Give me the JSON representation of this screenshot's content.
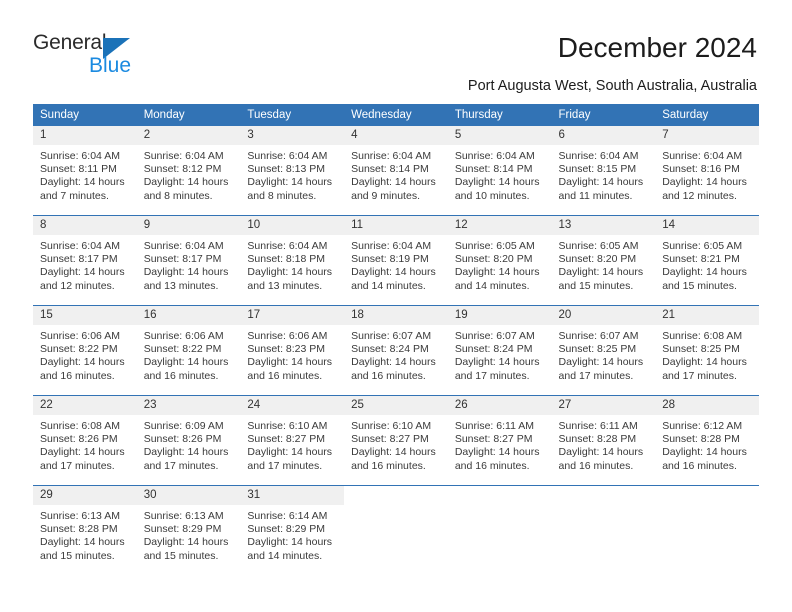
{
  "brand": {
    "name_top": "General",
    "name_bottom": "Blue",
    "accent_color": "#1b72b8",
    "accent_light": "#1b8ae0"
  },
  "header": {
    "title": "December 2024",
    "subtitle": "Port Augusta West, South Australia, Australia"
  },
  "theme": {
    "header_bg": "#3273b5",
    "daynum_bg": "#f0f0f0",
    "grid_line": "#3273b5",
    "text": "#3a3a3a"
  },
  "calendar": {
    "weekday_headers": [
      "Sunday",
      "Monday",
      "Tuesday",
      "Wednesday",
      "Thursday",
      "Friday",
      "Saturday"
    ],
    "weeks": [
      [
        {
          "day": "1",
          "sunrise": "Sunrise: 6:04 AM",
          "sunset": "Sunset: 8:11 PM",
          "daylight_1": "Daylight: 14 hours",
          "daylight_2": "and 7 minutes."
        },
        {
          "day": "2",
          "sunrise": "Sunrise: 6:04 AM",
          "sunset": "Sunset: 8:12 PM",
          "daylight_1": "Daylight: 14 hours",
          "daylight_2": "and 8 minutes."
        },
        {
          "day": "3",
          "sunrise": "Sunrise: 6:04 AM",
          "sunset": "Sunset: 8:13 PM",
          "daylight_1": "Daylight: 14 hours",
          "daylight_2": "and 8 minutes."
        },
        {
          "day": "4",
          "sunrise": "Sunrise: 6:04 AM",
          "sunset": "Sunset: 8:14 PM",
          "daylight_1": "Daylight: 14 hours",
          "daylight_2": "and 9 minutes."
        },
        {
          "day": "5",
          "sunrise": "Sunrise: 6:04 AM",
          "sunset": "Sunset: 8:14 PM",
          "daylight_1": "Daylight: 14 hours",
          "daylight_2": "and 10 minutes."
        },
        {
          "day": "6",
          "sunrise": "Sunrise: 6:04 AM",
          "sunset": "Sunset: 8:15 PM",
          "daylight_1": "Daylight: 14 hours",
          "daylight_2": "and 11 minutes."
        },
        {
          "day": "7",
          "sunrise": "Sunrise: 6:04 AM",
          "sunset": "Sunset: 8:16 PM",
          "daylight_1": "Daylight: 14 hours",
          "daylight_2": "and 12 minutes."
        }
      ],
      [
        {
          "day": "8",
          "sunrise": "Sunrise: 6:04 AM",
          "sunset": "Sunset: 8:17 PM",
          "daylight_1": "Daylight: 14 hours",
          "daylight_2": "and 12 minutes."
        },
        {
          "day": "9",
          "sunrise": "Sunrise: 6:04 AM",
          "sunset": "Sunset: 8:17 PM",
          "daylight_1": "Daylight: 14 hours",
          "daylight_2": "and 13 minutes."
        },
        {
          "day": "10",
          "sunrise": "Sunrise: 6:04 AM",
          "sunset": "Sunset: 8:18 PM",
          "daylight_1": "Daylight: 14 hours",
          "daylight_2": "and 13 minutes."
        },
        {
          "day": "11",
          "sunrise": "Sunrise: 6:04 AM",
          "sunset": "Sunset: 8:19 PM",
          "daylight_1": "Daylight: 14 hours",
          "daylight_2": "and 14 minutes."
        },
        {
          "day": "12",
          "sunrise": "Sunrise: 6:05 AM",
          "sunset": "Sunset: 8:20 PM",
          "daylight_1": "Daylight: 14 hours",
          "daylight_2": "and 14 minutes."
        },
        {
          "day": "13",
          "sunrise": "Sunrise: 6:05 AM",
          "sunset": "Sunset: 8:20 PM",
          "daylight_1": "Daylight: 14 hours",
          "daylight_2": "and 15 minutes."
        },
        {
          "day": "14",
          "sunrise": "Sunrise: 6:05 AM",
          "sunset": "Sunset: 8:21 PM",
          "daylight_1": "Daylight: 14 hours",
          "daylight_2": "and 15 minutes."
        }
      ],
      [
        {
          "day": "15",
          "sunrise": "Sunrise: 6:06 AM",
          "sunset": "Sunset: 8:22 PM",
          "daylight_1": "Daylight: 14 hours",
          "daylight_2": "and 16 minutes."
        },
        {
          "day": "16",
          "sunrise": "Sunrise: 6:06 AM",
          "sunset": "Sunset: 8:22 PM",
          "daylight_1": "Daylight: 14 hours",
          "daylight_2": "and 16 minutes."
        },
        {
          "day": "17",
          "sunrise": "Sunrise: 6:06 AM",
          "sunset": "Sunset: 8:23 PM",
          "daylight_1": "Daylight: 14 hours",
          "daylight_2": "and 16 minutes."
        },
        {
          "day": "18",
          "sunrise": "Sunrise: 6:07 AM",
          "sunset": "Sunset: 8:24 PM",
          "daylight_1": "Daylight: 14 hours",
          "daylight_2": "and 16 minutes."
        },
        {
          "day": "19",
          "sunrise": "Sunrise: 6:07 AM",
          "sunset": "Sunset: 8:24 PM",
          "daylight_1": "Daylight: 14 hours",
          "daylight_2": "and 17 minutes."
        },
        {
          "day": "20",
          "sunrise": "Sunrise: 6:07 AM",
          "sunset": "Sunset: 8:25 PM",
          "daylight_1": "Daylight: 14 hours",
          "daylight_2": "and 17 minutes."
        },
        {
          "day": "21",
          "sunrise": "Sunrise: 6:08 AM",
          "sunset": "Sunset: 8:25 PM",
          "daylight_1": "Daylight: 14 hours",
          "daylight_2": "and 17 minutes."
        }
      ],
      [
        {
          "day": "22",
          "sunrise": "Sunrise: 6:08 AM",
          "sunset": "Sunset: 8:26 PM",
          "daylight_1": "Daylight: 14 hours",
          "daylight_2": "and 17 minutes."
        },
        {
          "day": "23",
          "sunrise": "Sunrise: 6:09 AM",
          "sunset": "Sunset: 8:26 PM",
          "daylight_1": "Daylight: 14 hours",
          "daylight_2": "and 17 minutes."
        },
        {
          "day": "24",
          "sunrise": "Sunrise: 6:10 AM",
          "sunset": "Sunset: 8:27 PM",
          "daylight_1": "Daylight: 14 hours",
          "daylight_2": "and 17 minutes."
        },
        {
          "day": "25",
          "sunrise": "Sunrise: 6:10 AM",
          "sunset": "Sunset: 8:27 PM",
          "daylight_1": "Daylight: 14 hours",
          "daylight_2": "and 16 minutes."
        },
        {
          "day": "26",
          "sunrise": "Sunrise: 6:11 AM",
          "sunset": "Sunset: 8:27 PM",
          "daylight_1": "Daylight: 14 hours",
          "daylight_2": "and 16 minutes."
        },
        {
          "day": "27",
          "sunrise": "Sunrise: 6:11 AM",
          "sunset": "Sunset: 8:28 PM",
          "daylight_1": "Daylight: 14 hours",
          "daylight_2": "and 16 minutes."
        },
        {
          "day": "28",
          "sunrise": "Sunrise: 6:12 AM",
          "sunset": "Sunset: 8:28 PM",
          "daylight_1": "Daylight: 14 hours",
          "daylight_2": "and 16 minutes."
        }
      ],
      [
        {
          "day": "29",
          "sunrise": "Sunrise: 6:13 AM",
          "sunset": "Sunset: 8:28 PM",
          "daylight_1": "Daylight: 14 hours",
          "daylight_2": "and 15 minutes."
        },
        {
          "day": "30",
          "sunrise": "Sunrise: 6:13 AM",
          "sunset": "Sunset: 8:29 PM",
          "daylight_1": "Daylight: 14 hours",
          "daylight_2": "and 15 minutes."
        },
        {
          "day": "31",
          "sunrise": "Sunrise: 6:14 AM",
          "sunset": "Sunset: 8:29 PM",
          "daylight_1": "Daylight: 14 hours",
          "daylight_2": "and 14 minutes."
        },
        {
          "day": "",
          "sunrise": "",
          "sunset": "",
          "daylight_1": "",
          "daylight_2": ""
        },
        {
          "day": "",
          "sunrise": "",
          "sunset": "",
          "daylight_1": "",
          "daylight_2": ""
        },
        {
          "day": "",
          "sunrise": "",
          "sunset": "",
          "daylight_1": "",
          "daylight_2": ""
        },
        {
          "day": "",
          "sunrise": "",
          "sunset": "",
          "daylight_1": "",
          "daylight_2": ""
        }
      ]
    ]
  }
}
